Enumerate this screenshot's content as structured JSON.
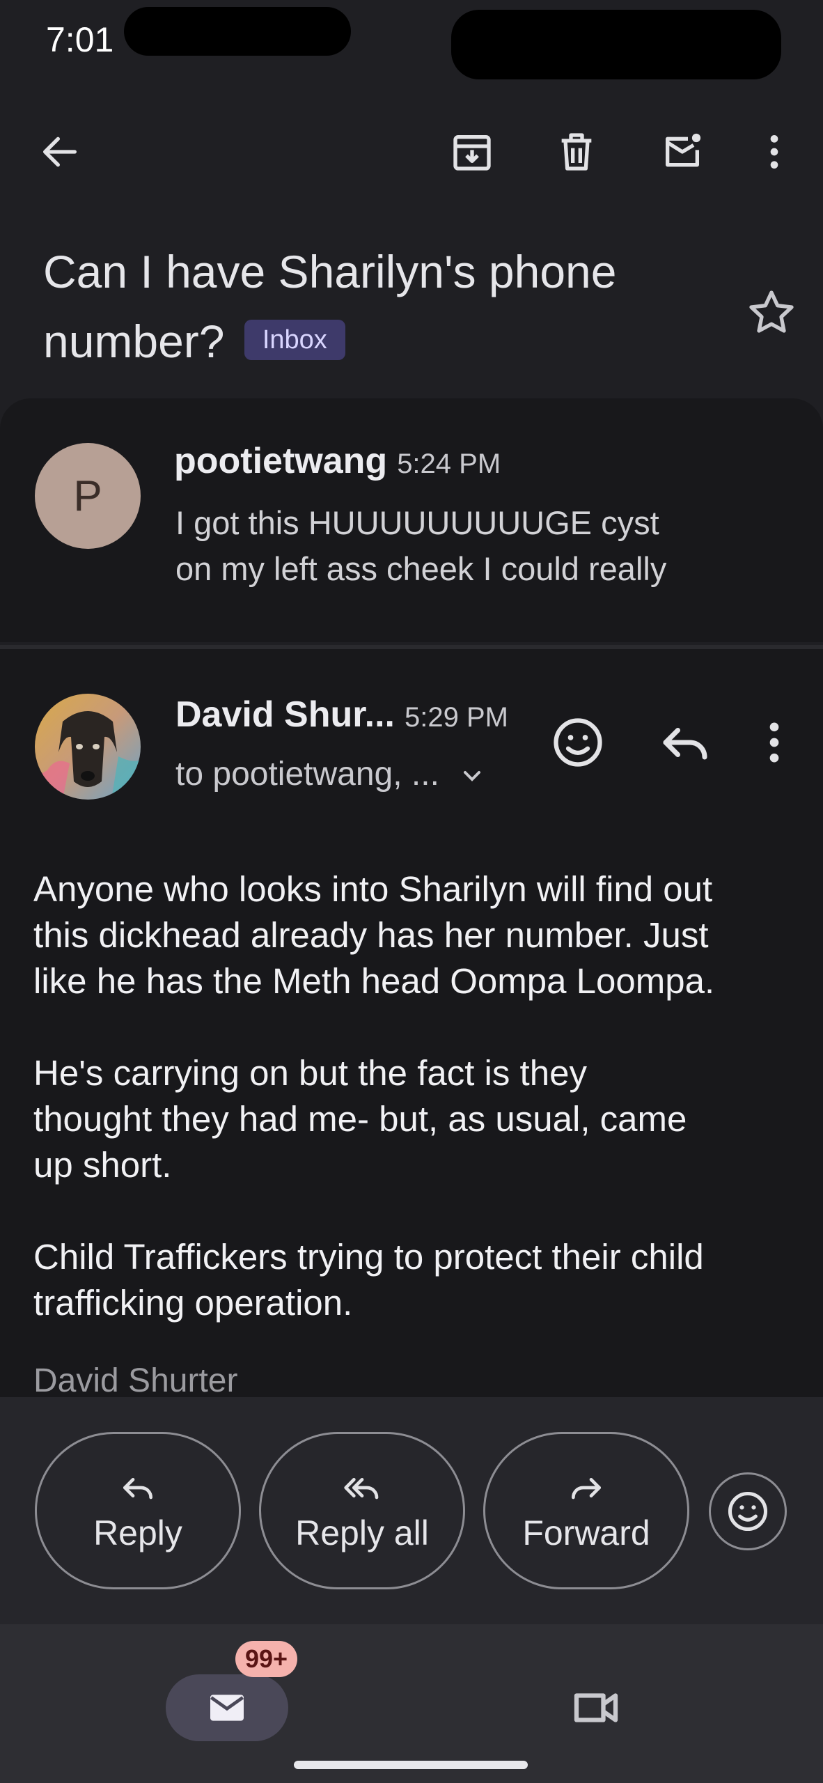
{
  "status_bar": {
    "time": "7:01"
  },
  "toolbar": {
    "back_icon": "arrow-left-icon",
    "archive_icon": "archive-icon",
    "delete_icon": "trash-icon",
    "mark_unread_icon": "mark-unread-icon",
    "more_icon": "more-vert-icon"
  },
  "subject": {
    "text": "Can I have Sharilyn's phone number?",
    "label": "Inbox",
    "star_icon": "star-outline-icon"
  },
  "messages": [
    {
      "avatar_letter": "P",
      "sender": "pootietwang",
      "time": "5:24 PM",
      "snippet_line1": "I got this HUUUUUUUUUGE cyst",
      "snippet_line2": "on my left ass cheek I could really"
    },
    {
      "sender": "David Shur...",
      "time": "5:29 PM",
      "recipients": "to pootietwang, ...",
      "body": [
        "Anyone who looks into Sharilyn will find out",
        "this dickhead already has her number. Just",
        "like he has the Meth head Oompa Loompa.",
        "He's carrying on but the fact is they",
        "thought they had me- but, as usual, came",
        "up short.",
        "Child Traffickers trying to protect their child",
        "trafficking operation."
      ],
      "signature_peek": "David Shurter"
    }
  ],
  "actions": {
    "reply": "Reply",
    "reply_all": "Reply all",
    "forward": "Forward"
  },
  "bottom_nav": {
    "mail_badge": "99+",
    "mail_icon": "mail-icon",
    "meet_icon": "video-camera-icon"
  },
  "colors": {
    "background": "#1f1f23",
    "card": "#18181b",
    "badge_bg": "#3e3a6a",
    "notification_badge": "#f5b2ad"
  }
}
